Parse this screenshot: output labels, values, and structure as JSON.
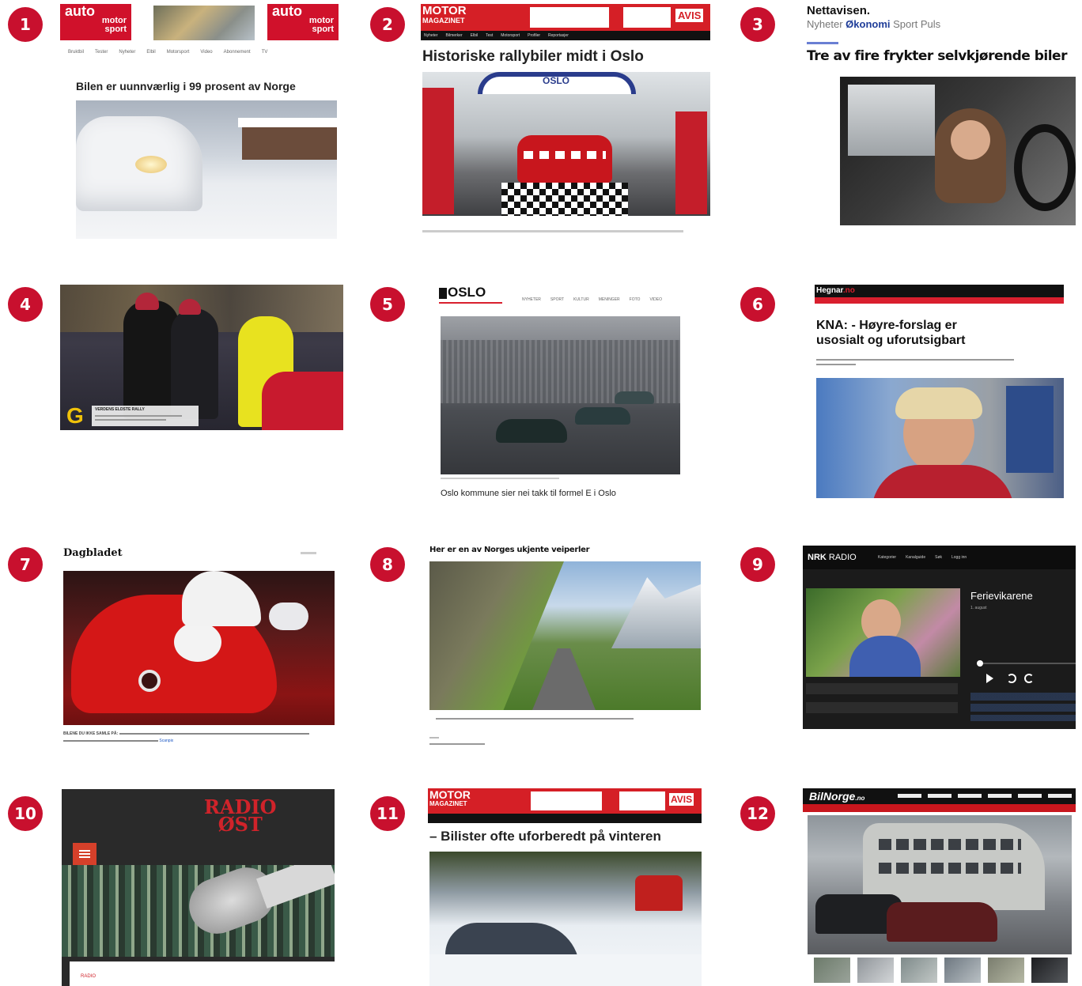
{
  "badges": [
    "1",
    "2",
    "3",
    "4",
    "5",
    "6",
    "7",
    "8",
    "9",
    "10",
    "11",
    "12"
  ],
  "s1": {
    "logo_line1": "auto",
    "logo_line2": "motor",
    "logo_line3": "sport",
    "nav": [
      "Bruktbil",
      "Tester",
      "Nyheter",
      "Elbil",
      "Motorsport",
      "Video",
      "Abonnement",
      "TV"
    ],
    "headline": "Bilen er uunnværlig i 99 prosent av Norge"
  },
  "s2": {
    "logo_line1": "MOTOR",
    "logo_line2": "MAGAZINET",
    "avis": "AVIS",
    "nav": [
      "Nyheter",
      "Bilmerker",
      "Elbil",
      "Test",
      "Motorsport",
      "Profiler",
      "Reportasjer"
    ],
    "headline": "Historiske rallybiler midt i Oslo",
    "arch_text": "OSLO"
  },
  "s3": {
    "brand": "Nettavisen.",
    "nav_nyheter": "Nyheter",
    "nav_okonomi": "Økonomi",
    "nav_sport": "Sport",
    "nav_puls": "Puls",
    "headline": "Tre av fire frykter selvkjørende biler"
  },
  "s4": {
    "lower_title": "VERDENS ELDSTE RALLY",
    "logo_letter": "G"
  },
  "s5": {
    "brand": "OSLO",
    "nav": [
      "NYHETER",
      "SPORT",
      "KULTUR",
      "MENINGER",
      "FOTO",
      "VIDEO"
    ],
    "headline": "Oslo kommune sier nei takk til formel E i Oslo"
  },
  "s6": {
    "brand": "Hegnar",
    "brand_suffix": ".no",
    "headline_line1": "KNA: - Høyre-forslag er",
    "headline_line2": "usosialt og uforutsigbart"
  },
  "s7": {
    "brand": "Dagbladet",
    "caption_bold": "BILENE DU IKKE SAMLE PÅ:",
    "caption_link": "Scanpix"
  },
  "s8": {
    "headline": "Her er en av Norges ukjente veiperler"
  },
  "s9": {
    "brand": "NRK",
    "brand2": "RADIO",
    "nav": [
      "Kategorier",
      "Kanalguide",
      "Søk",
      "Logg inn"
    ],
    "show_title": "Ferievikarene",
    "show_date": "1. august"
  },
  "s10": {
    "logo_line1": "RADIO",
    "logo_line2": "ØST",
    "tag": "RADIO"
  },
  "s11": {
    "logo_line1": "MOTOR",
    "logo_line2": "MAGAZINET",
    "avis": "AVIS",
    "headline": "– Bilister ofte uforberedt på vinteren"
  },
  "s12": {
    "brand": "BilNorge",
    "brand_suffix": ".no"
  }
}
